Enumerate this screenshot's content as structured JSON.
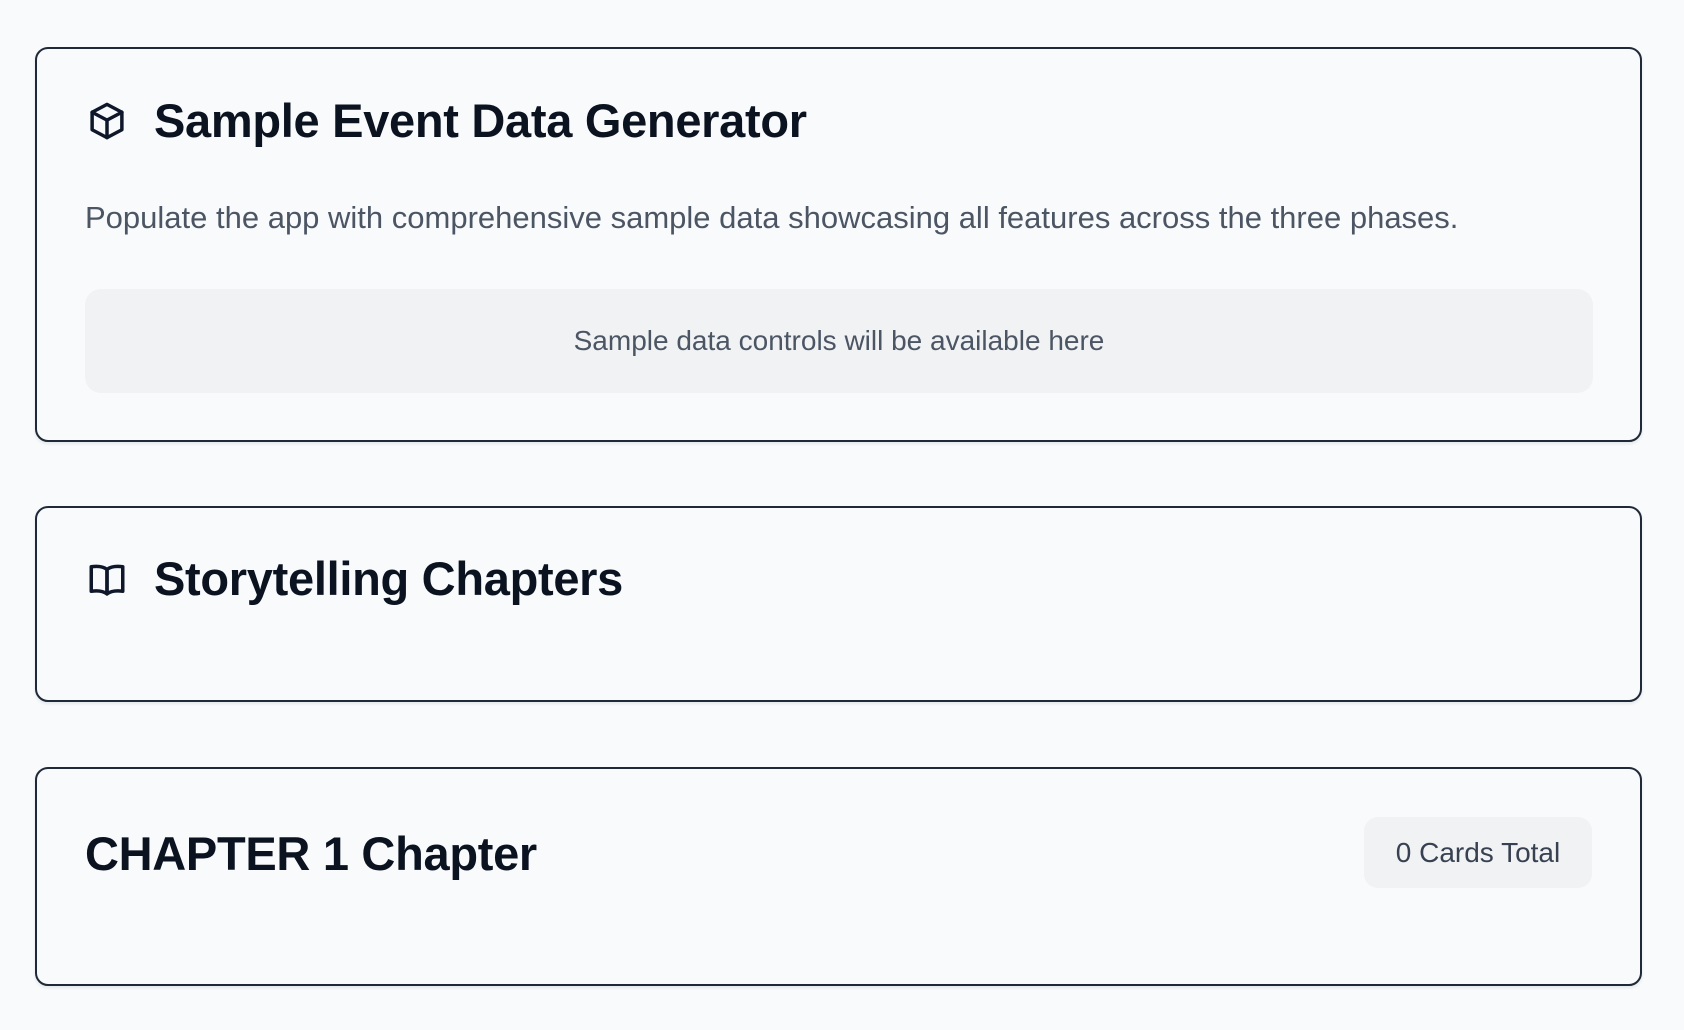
{
  "generator": {
    "icon": "cube-icon",
    "title": "Sample Event Data Generator",
    "description": "Populate the app with comprehensive sample data showcasing all features across the three phases.",
    "controls_placeholder": "Sample data controls will be available here"
  },
  "storytelling": {
    "icon": "book-open-icon",
    "title": "Storytelling Chapters"
  },
  "chapter": {
    "title": "CHAPTER 1 Chapter",
    "cards_total": "0 Cards Total"
  },
  "colors": {
    "background": "#f8fafc",
    "card_border": "#1f2937",
    "muted_fill": "#f1f2f4",
    "muted_text": "#4b5563",
    "heading_text": "#0b1220"
  }
}
